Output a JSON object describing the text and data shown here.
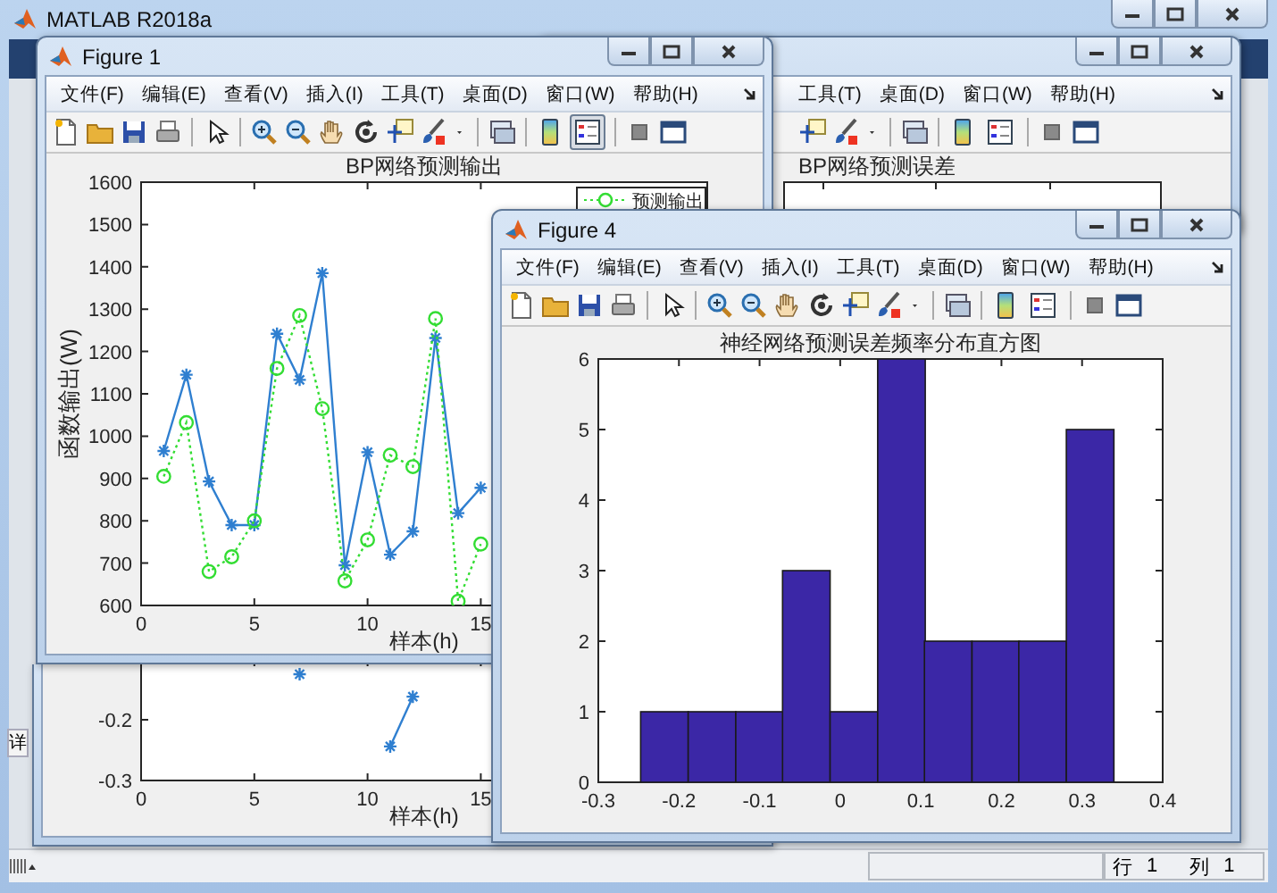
{
  "main_window": {
    "title": "MATLAB R2018a",
    "side_tab": "详",
    "status_bar": {
      "row_label": "行",
      "row_value": "1",
      "col_label": "列",
      "col_value": "1"
    }
  },
  "windows": [
    {
      "kind": "lower_fragment",
      "chart_data": {
        "type": "line",
        "xlabel": "样本(h)",
        "x": [
          7,
          11,
          12
        ],
        "series": [
          {
            "color": "#2f7fd0",
            "line_style": "none",
            "marker": "cross",
            "values": [
              -0.125,
              null,
              null
            ]
          },
          {
            "color": "#2f7fd0",
            "line_style": "solid",
            "marker": "cross",
            "values": [
              null,
              -0.244,
              -0.162
            ]
          }
        ],
        "xlim": [
          0,
          25
        ],
        "ylim": [
          -0.3,
          -0.1
        ],
        "xticks": [
          0,
          5,
          10,
          15
        ],
        "yticks": [
          -0.3,
          -0.2
        ]
      }
    },
    {
      "kind": "upper_fragment",
      "menu": [
        "工具(T)",
        "桌面(D)",
        "窗口(W)",
        "帮助(H)"
      ],
      "legend_button_pressed": false,
      "plot_title": "BP网络预测误差"
    },
    {
      "kind": "figure",
      "title": "Figure 1",
      "menu": [
        "文件(F)",
        "编辑(E)",
        "查看(V)",
        "插入(I)",
        "工具(T)",
        "桌面(D)",
        "窗口(W)",
        "帮助(H)"
      ],
      "legend_button_pressed": true,
      "chart_data": {
        "type": "line",
        "title": "BP网络预测输出",
        "xlabel": "样本(h)",
        "ylabel": "函数输出(W)",
        "x": [
          1,
          2,
          3,
          4,
          5,
          6,
          7,
          8,
          9,
          10,
          11,
          12,
          13,
          14,
          15
        ],
        "series": [
          {
            "color": "#2f7fd0",
            "line_style": "solid",
            "marker": "cross",
            "values": [
              965,
              1145,
              893,
              790,
              790,
              1242,
              1133,
              1385,
              695,
              962,
              720,
              775,
              1232,
              818,
              878
            ]
          },
          {
            "name": "预测输出",
            "color": "#33dd33",
            "line_style": "dotted",
            "marker": "circle",
            "values": [
              905,
              1032,
              680,
              715,
              800,
              1160,
              1285,
              1065,
              658,
              755,
              955,
              928,
              1278,
              610,
              745
            ]
          }
        ],
        "xlim": [
          0,
          25
        ],
        "ylim": [
          600,
          1600
        ],
        "xticks": [
          0,
          5,
          10,
          15
        ],
        "yticks": [
          600,
          700,
          800,
          900,
          1000,
          1100,
          1200,
          1300,
          1400,
          1500,
          1600
        ]
      }
    },
    {
      "kind": "figure",
      "title": "Figure 4",
      "menu": [
        "文件(F)",
        "编辑(E)",
        "查看(V)",
        "插入(I)",
        "工具(T)",
        "桌面(D)",
        "窗口(W)",
        "帮助(H)"
      ],
      "legend_button_pressed": false,
      "chart_data": {
        "type": "bar",
        "title": "神经网络预测误差频率分布直方图",
        "x": [
          -0.218,
          -0.159,
          -0.1,
          -0.042,
          0.017,
          0.076,
          0.134,
          0.193,
          0.251,
          0.31
        ],
        "series": [
          {
            "color": "#3b27a6",
            "values": [
              1,
              1,
              1,
              3,
              1,
              6,
              2,
              2,
              2,
              5
            ]
          }
        ],
        "xlim": [
          -0.3,
          0.4
        ],
        "ylim": [
          0,
          6
        ],
        "xticks": [
          -0.3,
          -0.2,
          -0.1,
          0,
          0.1,
          0.2,
          0.3,
          0.4
        ],
        "yticks": [
          0,
          1,
          2,
          3,
          4,
          5,
          6
        ]
      }
    }
  ]
}
